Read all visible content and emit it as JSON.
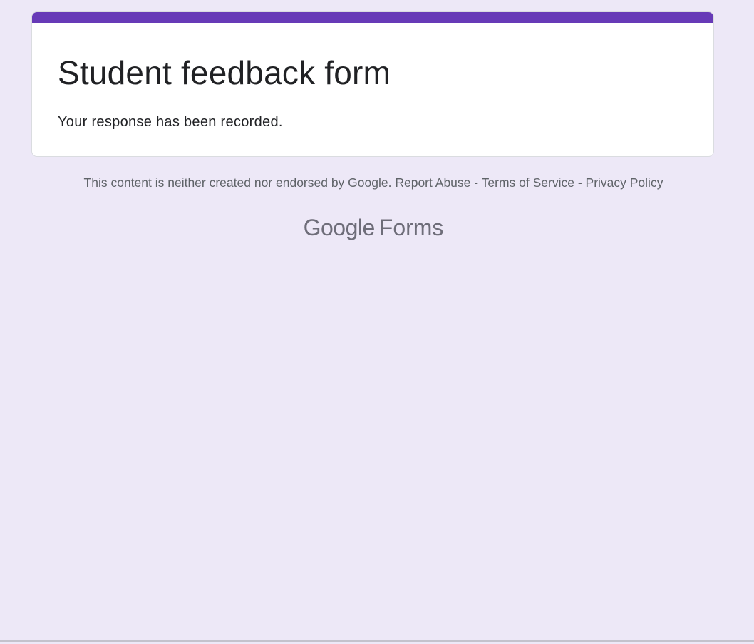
{
  "colors": {
    "page_background": "#ede8f7",
    "accent": "#673ab7",
    "card_background": "#ffffff",
    "title_text": "#202124",
    "footer_text": "#5f6368"
  },
  "form": {
    "title": "Student feedback form",
    "confirmation_message": "Your response has been recorded."
  },
  "footer": {
    "disclaimer": "This content is neither created nor endorsed by Google.",
    "separator": "-",
    "links": {
      "report_abuse": "Report Abuse",
      "terms_of_service": "Terms of Service",
      "privacy_policy": "Privacy Policy"
    }
  },
  "branding": {
    "company": "Google",
    "product": "Forms"
  }
}
